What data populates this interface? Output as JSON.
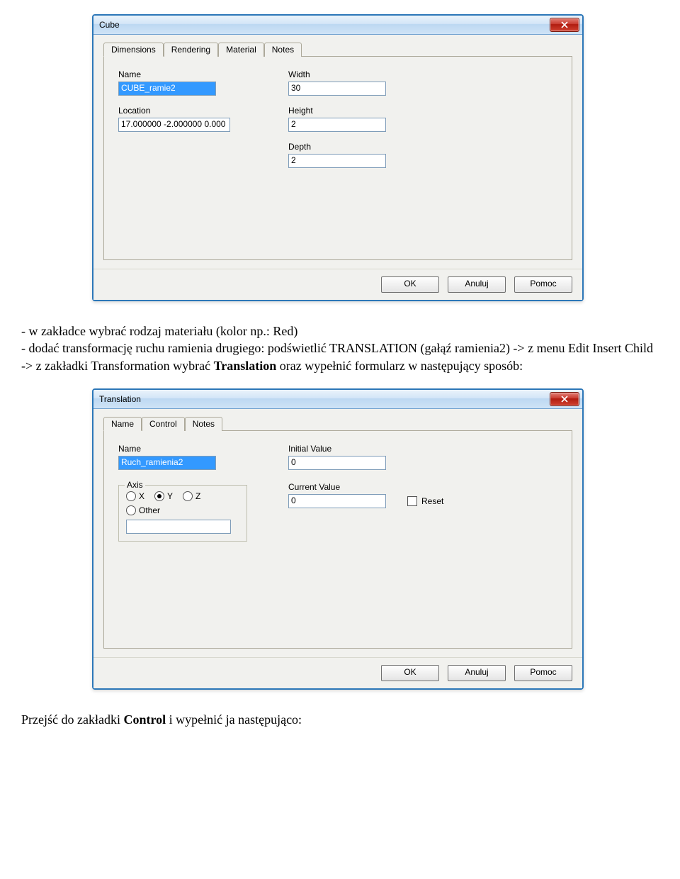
{
  "dialog1": {
    "title": "Cube",
    "tabs": [
      "Dimensions",
      "Rendering",
      "Material",
      "Notes"
    ],
    "name_label": "Name",
    "name_value": "CUBE_ramie2",
    "location_label": "Location",
    "location_value": "17.000000 -2.000000 0.000",
    "width_label": "Width",
    "width_value": "30",
    "height_label": "Height",
    "height_value": "2",
    "depth_label": "Depth",
    "depth_value": "2",
    "ok": "OK",
    "cancel": "Anuluj",
    "help": "Pomoc"
  },
  "para1": {
    "line1": "- w zakładce wybrać rodzaj materiału (kolor np.: Red)",
    "line2a": "- dodać transformację ruchu ramienia drugiego: podświetlić TRANSLATION (gałąź ramienia2) -> z menu Edit Insert Child -> z zakładki Transformation wybrać ",
    "line2b": "Translation",
    "line2c": " oraz wypełnić formularz w następujący sposób:"
  },
  "dialog2": {
    "title": "Translation",
    "tabs": [
      "Name",
      "Control",
      "Notes"
    ],
    "name_label": "Name",
    "name_value": "Ruch_ramienia2",
    "initial_label": "Initial Value",
    "initial_value": "0",
    "current_label": "Current Value",
    "current_value": "0",
    "axis_label": "Axis",
    "axis_x": "X",
    "axis_y": "Y",
    "axis_z": "Z",
    "axis_other": "Other",
    "reset": "Reset",
    "ok": "OK",
    "cancel": "Anuluj",
    "help": "Pomoc"
  },
  "para2": {
    "a": "Przejść do zakładki ",
    "b": "Control",
    "c": " i wypełnić ja następująco:"
  }
}
